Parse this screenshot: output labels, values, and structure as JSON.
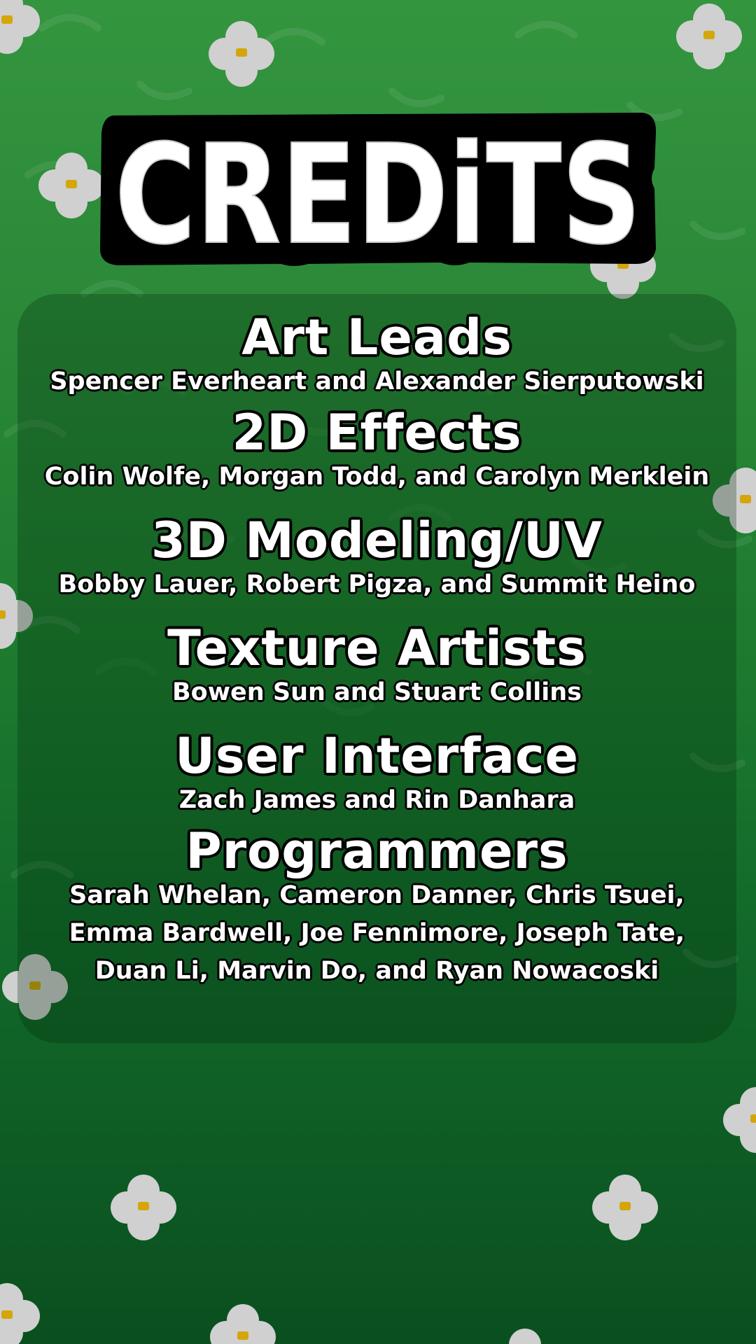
{
  "screen": {
    "title": "CREDiTS",
    "background_color": "#1e7a30",
    "flower_color": "#cfd0cf",
    "flower_center_color": "#d4a60a"
  },
  "credits": [
    {
      "role": "Art Leads",
      "names": [
        "Spencer Everheart and Alexander Sierputowski"
      ]
    },
    {
      "role": "2D Effects",
      "names": [
        "Colin Wolfe, Morgan Todd, and Carolyn Merklein"
      ]
    },
    {
      "role": "3D Modeling/UV",
      "names": [
        "Bobby Lauer, Robert Pigza, and Summit Heino"
      ]
    },
    {
      "role": "Texture Artists",
      "names": [
        "Bowen Sun and Stuart Collins"
      ]
    },
    {
      "role": "User Interface",
      "names": [
        "Zach James and Rin Danhara"
      ]
    },
    {
      "role": "Programmers",
      "names": [
        "Sarah Whelan, Cameron Danner, Chris Tsuei,",
        "Emma Bardwell, Joe Fennimore, Joseph Tate,",
        "Duan Li, Marvin Do, and Ryan Nowacoski"
      ]
    }
  ]
}
